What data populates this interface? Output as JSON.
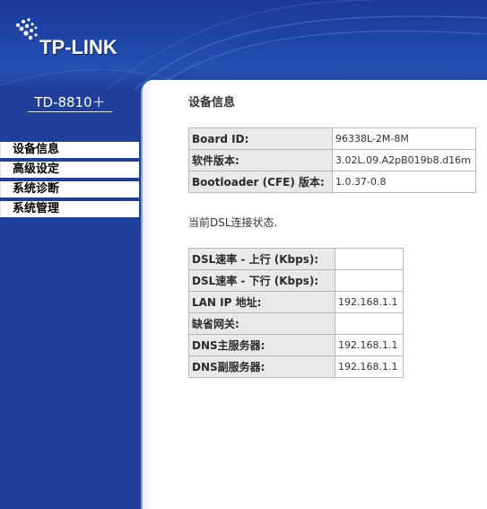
{
  "brand": {
    "logo_text": "TP-LINK",
    "model": "TD-8810＋"
  },
  "colors": {
    "sidebar_bg": "#1f3f9a",
    "panel_bg": "#ffffff",
    "table_key_bg": "#e9e9e9",
    "table_border": "#b9b9b9"
  },
  "nav": {
    "items": [
      {
        "label": "设备信息"
      },
      {
        "label": "高级设定"
      },
      {
        "label": "系统诊断"
      },
      {
        "label": "系统管理"
      }
    ]
  },
  "main": {
    "title": "设备信息",
    "device_table": [
      {
        "key": "Board ID:",
        "value": "96338L-2M-8M"
      },
      {
        "key": "软件版本:",
        "value": "3.02L.09.A2pB019b8.d16m"
      },
      {
        "key": "Bootloader (CFE) 版本:",
        "value": "1.0.37-0.8"
      }
    ],
    "status_note": "当前DSL连接状态.",
    "dsl_table": [
      {
        "key": "DSL速率 - 上行 (Kbps):",
        "value": ""
      },
      {
        "key": "DSL速率 - 下行 (Kbps):",
        "value": ""
      },
      {
        "key": "LAN IP 地址:",
        "value": "192.168.1.1"
      },
      {
        "key": "缺省网关:",
        "value": ""
      },
      {
        "key": "DNS主服务器:",
        "value": "192.168.1.1"
      },
      {
        "key": "DNS副服务器:",
        "value": "192.168.1.1"
      }
    ]
  }
}
